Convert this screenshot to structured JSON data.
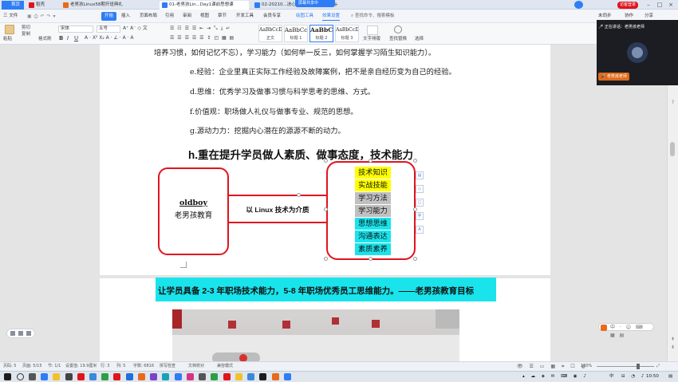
{
  "tabs": [
    {
      "label": "首页"
    },
    {
      "label": "稻壳"
    },
    {
      "label": "老男孩Linux58期开班典礼"
    },
    {
      "label": "01-老男孩Lin...Day1课前思想课"
    },
    {
      "label": "02-20210...决心书讲师与宣誓"
    }
  ],
  "screen_share": {
    "status": "屏幕共享中",
    "stop": "停止共享"
  },
  "account": {
    "login_button": "访客登录"
  },
  "menu": {
    "file": "三 文件",
    "items": [
      "开始",
      "插入",
      "页面布局",
      "引用",
      "审阅",
      "视图",
      "章节",
      "开发工具",
      "会员专享",
      "绘图工具",
      "效果设置"
    ],
    "search": "查找命令、搜索模板",
    "right": [
      "未同步",
      "协作",
      "分享"
    ]
  },
  "ribbon": {
    "paste": "粘贴",
    "cut": "剪切",
    "copy": "复制",
    "format_painter": "格式刷",
    "font_name": "宋体",
    "font_size": "五号",
    "styles": [
      {
        "sample": "AaBbCcDd",
        "label": "正文"
      },
      {
        "sample": "AaBbCc",
        "label": "标题 1"
      },
      {
        "sample": "AaBbC",
        "label": "标题 2"
      },
      {
        "sample": "AaBbCcD",
        "label": "标题 3"
      }
    ],
    "text_tools": "文字排版",
    "find_replace": "查找替换",
    "select": "选择"
  },
  "document": {
    "lines": [
      "培养习惯，如何记忆不忘），学习能力（如何举一反三，如何掌握学习陌生知识能力）。",
      "e.经验：企业里真正实际工作经验及故障案例，把不是亲自经历变为自己的经验。",
      "d.思维：优秀学习及做事习惯与科学思考的思维、方式。",
      "f.价值观：职场做人礼仪与做事专业、规范的思想。",
      "g.源动力力：挖掘内心潜在的源源不断的动力。"
    ],
    "heading": "h.重在提升学员做人素质、做事态度，技术能力",
    "diagram": {
      "left_title": "oldboy",
      "left_subtitle": "老男孩教育",
      "connector": "以 Linux 技术为介质",
      "skills": [
        {
          "text": "技术知识",
          "bg": "#ffff00"
        },
        {
          "text": "实战技能",
          "bg": "#ffff00"
        },
        {
          "text": "学习方法",
          "bg": "#c0c0c0"
        },
        {
          "text": "学习能力",
          "bg": "#c0c0c0"
        },
        {
          "text": "思想思维",
          "bg": "#19e4ec"
        },
        {
          "text": "沟通表达",
          "bg": "#19e4ec"
        },
        {
          "text": "素质素养",
          "bg": "#19e4ec"
        }
      ]
    },
    "banner": "让学员具备 2-3 年职场技术能力，5-8 年职场优秀员工思维能力。——老男孩教育目标"
  },
  "video": {
    "speaking": "正在讲话：老男孩老师",
    "name": "老男孩老师"
  },
  "status": {
    "page": "页码: 5",
    "pages": "页面: 5/15",
    "section": "节: 1/1",
    "setting": "设置值: 19.9厘米",
    "row": "行: 3",
    "col": "列: 5",
    "words": "字数: 6816",
    "spell": "拼写检查",
    "doc_check": "文档校对",
    "compat": "兼容模式",
    "zoom": "180%"
  },
  "taskbar": {
    "time": "10:50",
    "ime": "中"
  },
  "colors": {
    "accent": "#2f7df6",
    "red": "#e0141e",
    "cyan": "#19e4ec",
    "yellow": "#ffff00",
    "gray": "#c0c0c0"
  }
}
